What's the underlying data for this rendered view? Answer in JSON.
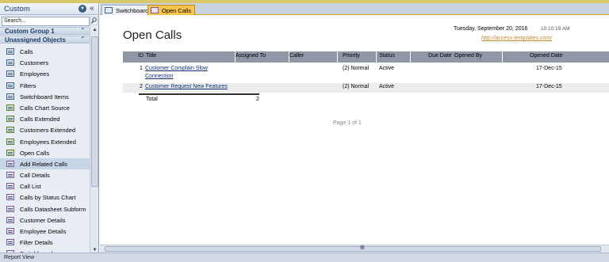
{
  "nav": {
    "title": "Custom",
    "search_placeholder": "Search...",
    "groups": [
      "Custom Group 1",
      "Unassigned Objects"
    ],
    "items": [
      {
        "label": "Calls",
        "type": "table"
      },
      {
        "label": "Customers",
        "type": "table"
      },
      {
        "label": "Employees",
        "type": "table"
      },
      {
        "label": "Filters",
        "type": "table"
      },
      {
        "label": "Switchboard Items",
        "type": "table"
      },
      {
        "label": "Calls Chart Source",
        "type": "form"
      },
      {
        "label": "Calls Extended",
        "type": "form"
      },
      {
        "label": "Customers Extended",
        "type": "form"
      },
      {
        "label": "Employees Extended",
        "type": "form"
      },
      {
        "label": "Open Calls",
        "type": "form"
      },
      {
        "label": "Add Related Calls",
        "type": "report"
      },
      {
        "label": "Call Details",
        "type": "report"
      },
      {
        "label": "Call List",
        "type": "report"
      },
      {
        "label": "Calls by Status Chart",
        "type": "report"
      },
      {
        "label": "Calls Datasheet Subform",
        "type": "report"
      },
      {
        "label": "Customer Details",
        "type": "report"
      },
      {
        "label": "Employee Details",
        "type": "report"
      },
      {
        "label": "Filter Details",
        "type": "report"
      },
      {
        "label": "Switchboard",
        "type": "report"
      }
    ],
    "selected_item": "Add Related Calls"
  },
  "tabs": [
    {
      "label": "Switchboard",
      "active": false
    },
    {
      "label": "Open Calls",
      "active": true
    }
  ],
  "report": {
    "title": "Open Calls",
    "date": "Tuesday, September 20, 2016",
    "time": "10:10:19 AM",
    "link": "http://access-templates.com/",
    "columns": [
      "ID",
      "Title",
      "Assigned To",
      "Caller",
      "Priority",
      "Status",
      "Due Date",
      "Opened By",
      "Opened Date"
    ],
    "rows": [
      {
        "id": "1",
        "title_line1": "Customer Complain Slow",
        "title_line2": "Connection",
        "priority": "(2) Normal",
        "status": "Active",
        "opened_date": "17-Dec-15"
      },
      {
        "id": "2",
        "title_line1": "Customer Request New Features",
        "priority": "(2) Normal",
        "status": "Active",
        "opened_date": "17-Dec-15"
      }
    ],
    "total_label": "Total",
    "total_value": "2",
    "page": "Page 1 of 1"
  },
  "status_bar": "Report View",
  "colors": {
    "accent_tab": "#f7c54a",
    "header_row": "#8f97a6",
    "link": "#c08a2a"
  }
}
